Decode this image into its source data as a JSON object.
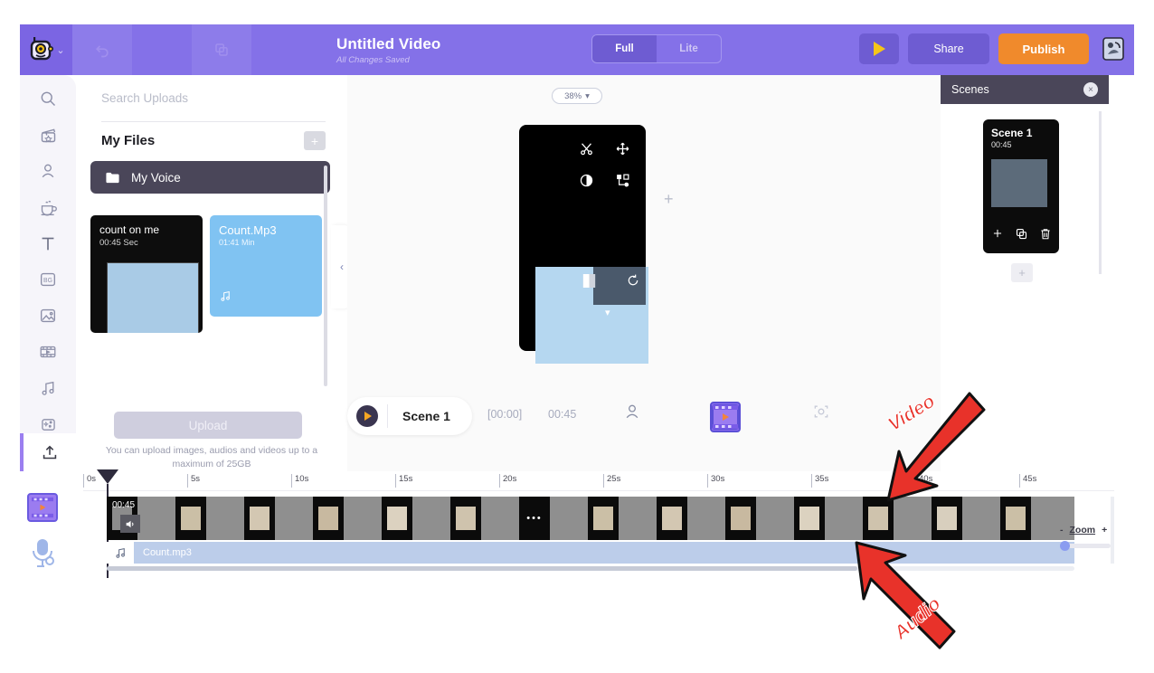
{
  "header": {
    "logo_icon": "app-logo-icon",
    "logo_chevron": "⌄",
    "undo_icon": "undo-icon",
    "copy_icon": "duplicate-icon",
    "extra_icon": "more-icon",
    "title": "Untitled Video",
    "subtitle": "All Changes Saved",
    "mode_toggle": {
      "options": [
        "Full",
        "Lite"
      ],
      "selected": "Full"
    },
    "play_label": "play-icon",
    "share_label": "Share",
    "publish_label": "Publish",
    "avatar_icon": "user-avatar-icon"
  },
  "left_rail": {
    "items": [
      {
        "name": "search-icon",
        "label": "Search"
      },
      {
        "name": "scene-icon",
        "label": "Scenes"
      },
      {
        "name": "character-icon",
        "label": "Characters"
      },
      {
        "name": "props-icon",
        "label": "Props"
      },
      {
        "name": "text-icon",
        "label": "T"
      },
      {
        "name": "background-icon",
        "label": "BG"
      },
      {
        "name": "image-icon",
        "label": "Images"
      },
      {
        "name": "video-icon",
        "label": "Video"
      },
      {
        "name": "music-icon",
        "label": "Music"
      },
      {
        "name": "effects-icon",
        "label": "Effects"
      }
    ],
    "upload": {
      "name": "upload-icon",
      "label": "Upload",
      "active": true
    }
  },
  "uploads_panel": {
    "search_placeholder": "Search Uploads",
    "section_title": "My Files",
    "add_button": "+",
    "folder": {
      "label": "My Voice",
      "icon": "folder-icon"
    },
    "media": [
      {
        "title": "count on me",
        "meta": "00:45 Sec",
        "type": "video"
      },
      {
        "title": "Count.Mp3",
        "meta": "01:41 Min",
        "type": "audio"
      }
    ],
    "upload_button": "Upload",
    "upload_note": "You can upload images, audios and videos up to a maximum of 25GB",
    "collapse_icon": "‹"
  },
  "canvas": {
    "zoom_value": "38%",
    "zoom_caret": "▾",
    "add_icon": "+",
    "toolbar": [
      {
        "name": "cut-icon"
      },
      {
        "name": "move-icon"
      },
      {
        "name": "contrast-icon"
      },
      {
        "name": "layers-icon"
      },
      {
        "name": "crop-icon"
      },
      {
        "name": "rotate-icon"
      },
      {
        "name": "expand-chevron-icon"
      }
    ]
  },
  "scene_bar": {
    "play_icon": "play-icon",
    "scene_name": "Scene 1",
    "start_time": "[00:00]",
    "duration": "00:45",
    "character_icon": "character-icon",
    "video_icon": "video-clip-icon",
    "focus_icon": "focus-icon"
  },
  "scenes_panel": {
    "title": "Scenes",
    "close_icon": "×",
    "scene": {
      "name": "Scene 1",
      "duration": "00:45",
      "tools": [
        {
          "name": "add-scene-icon",
          "glyph": "+"
        },
        {
          "name": "duplicate-scene-icon",
          "glyph": "⧉"
        },
        {
          "name": "delete-scene-icon",
          "glyph": "Ὕ1"
        }
      ]
    },
    "add_scene_button": "+"
  },
  "timeline": {
    "ticks": [
      "0s",
      "5s",
      "10s",
      "15s",
      "20s",
      "25s",
      "30s",
      "35s",
      "40s",
      "45s"
    ],
    "video_track": {
      "icon": "video-track-icon",
      "duration_label": "00:45",
      "volume_icon": "volume-icon",
      "frame_count": 14,
      "dots_frame_index": 6,
      "dots_glyph": "•••"
    },
    "audio_track": {
      "icon": "mic-track-icon",
      "clip_icon": "music-note-icon",
      "clip_name": "Count.mp3"
    },
    "zoom": {
      "minus": "-",
      "label": "Zoom",
      "plus": "+"
    }
  },
  "annotations": [
    {
      "label": "Video",
      "arrow": "down-left-arrow"
    },
    {
      "label": "Audio",
      "arrow": "up-left-arrow"
    }
  ]
}
